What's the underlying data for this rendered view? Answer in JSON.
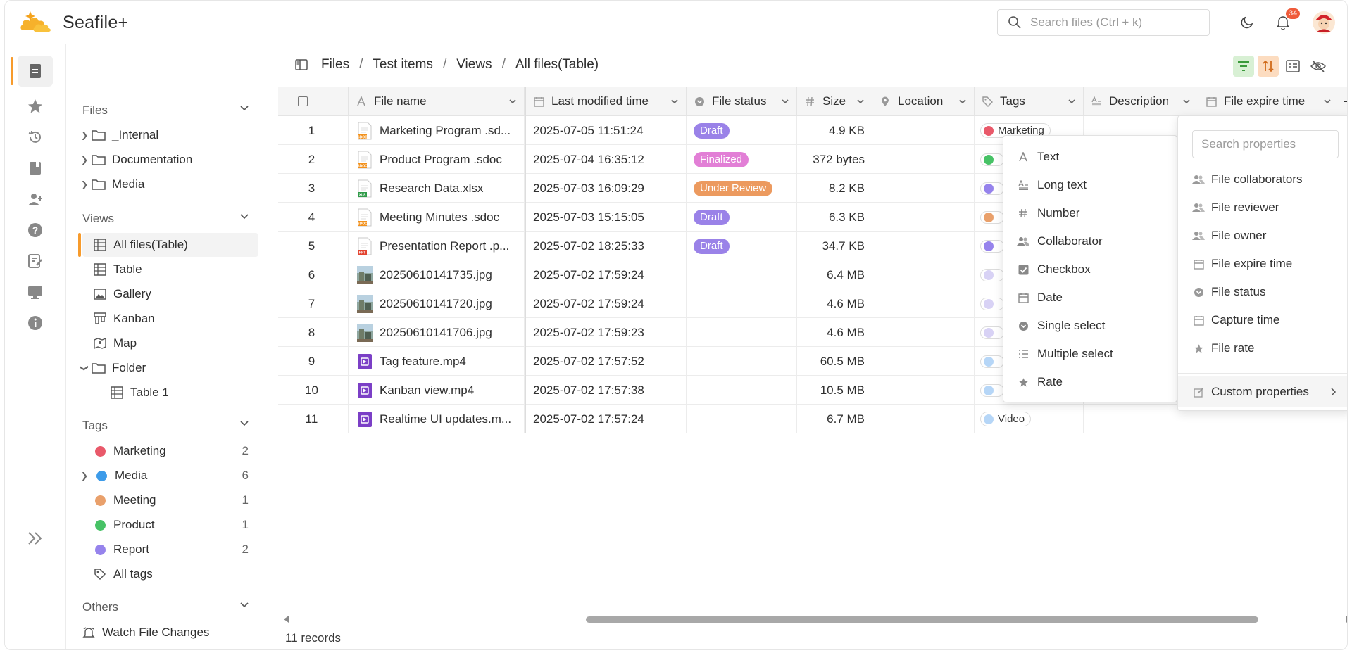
{
  "app": {
    "name": "Seafile+"
  },
  "header": {
    "search_placeholder": "Search files (Ctrl + k)",
    "notification_count": "34"
  },
  "breadcrumb": [
    "Files",
    "Test items",
    "Views",
    "All files(Table)"
  ],
  "sidebar": {
    "files_section": "Files",
    "files": [
      "_Internal",
      "Documentation",
      "Media"
    ],
    "views_section": "Views",
    "views": [
      "All files(Table)",
      "Table",
      "Gallery",
      "Kanban",
      "Map",
      "Folder",
      "Table 1"
    ],
    "tags_section": "Tags",
    "tags": [
      {
        "name": "Marketing",
        "count": "2",
        "color": "#e9596a"
      },
      {
        "name": "Media",
        "count": "6",
        "color": "#3d9be9"
      },
      {
        "name": "Meeting",
        "count": "1",
        "color": "#e9a06b"
      },
      {
        "name": "Product",
        "count": "1",
        "color": "#47c266"
      },
      {
        "name": "Report",
        "count": "2",
        "color": "#9683ec"
      }
    ],
    "all_tags": "All tags",
    "others_section": "Others",
    "others": [
      "Watch File Changes"
    ]
  },
  "table": {
    "columns": [
      "File name",
      "Last modified time",
      "File status",
      "Size",
      "Location",
      "Tags",
      "Description",
      "File expire time"
    ],
    "rows": [
      {
        "n": "1",
        "name": "Marketing Program .sd...",
        "modified": "2025-07-05 11:51:24",
        "status": "Draft",
        "size": "4.9 KB",
        "tag": "Marketing"
      },
      {
        "n": "2",
        "name": "Product Program .sdoc",
        "modified": "2025-07-04 16:35:12",
        "status": "Finalized",
        "size": "372 bytes",
        "tag": ""
      },
      {
        "n": "3",
        "name": "Research Data.xlsx",
        "modified": "2025-07-03 16:09:29",
        "status": "Under Review",
        "size": "8.2 KB",
        "tag": ""
      },
      {
        "n": "4",
        "name": "Meeting Minutes .sdoc",
        "modified": "2025-07-03 15:15:05",
        "status": "Draft",
        "size": "6.3 KB",
        "tag": ""
      },
      {
        "n": "5",
        "name": "Presentation Report .p...",
        "modified": "2025-07-02 18:25:33",
        "status": "Draft",
        "size": "34.7 KB",
        "tag": ""
      },
      {
        "n": "6",
        "name": "20250610141735.jpg",
        "modified": "2025-07-02 17:59:24",
        "status": "",
        "size": "6.4 MB",
        "tag": ""
      },
      {
        "n": "7",
        "name": "20250610141720.jpg",
        "modified": "2025-07-02 17:59:24",
        "status": "",
        "size": "4.6 MB",
        "tag": ""
      },
      {
        "n": "8",
        "name": "20250610141706.jpg",
        "modified": "2025-07-02 17:59:23",
        "status": "",
        "size": "4.6 MB",
        "tag": ""
      },
      {
        "n": "9",
        "name": "Tag feature.mp4",
        "modified": "2025-07-02 17:57:52",
        "status": "",
        "size": "60.5 MB",
        "tag": ""
      },
      {
        "n": "10",
        "name": "Kanban view.mp4",
        "modified": "2025-07-02 17:57:38",
        "status": "",
        "size": "10.5 MB",
        "tag": ""
      },
      {
        "n": "11",
        "name": "Realtime UI updates.m...",
        "modified": "2025-07-02 17:57:24",
        "status": "",
        "size": "6.7 MB",
        "tag": "Video"
      }
    ],
    "status_colors": {
      "Draft": "#9a82e8",
      "Finalized": "#e27fd6",
      "Under Review": "#ec9a5f"
    },
    "records_label": "11 records"
  },
  "type_menu": [
    "Text",
    "Long text",
    "Number",
    "Collaborator",
    "Checkbox",
    "Date",
    "Single select",
    "Multiple select",
    "Rate"
  ],
  "property_menu": {
    "search_placeholder": "Search properties",
    "items": [
      "File collaborators",
      "File reviewer",
      "File owner",
      "File expire time",
      "File status",
      "Capture time",
      "File rate"
    ],
    "custom": "Custom properties"
  }
}
